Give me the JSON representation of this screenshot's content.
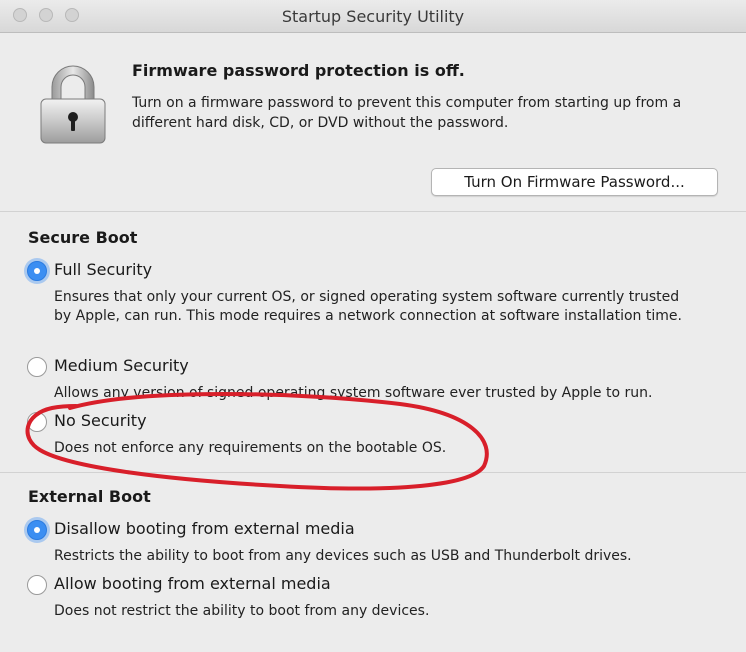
{
  "window": {
    "title": "Startup Security Utility"
  },
  "firmware": {
    "heading": "Firmware password protection is off.",
    "description": "Turn on a firmware password to prevent this computer from starting up from a different hard disk, CD, or DVD without the password.",
    "button_label": "Turn On Firmware Password..."
  },
  "secure_boot": {
    "title": "Secure Boot",
    "options": [
      {
        "label": "Full Security",
        "description": "Ensures that only your current OS, or signed operating system software currently trusted by Apple, can run. This mode requires a network connection at software installation time.",
        "selected": true
      },
      {
        "label": "Medium Security",
        "description": "Allows any version of signed operating system software ever trusted by Apple to run.",
        "selected": false
      },
      {
        "label": "No Security",
        "description": "Does not enforce any requirements on the bootable OS.",
        "selected": false
      }
    ]
  },
  "external_boot": {
    "title": "External Boot",
    "options": [
      {
        "label": "Disallow booting from external media",
        "description": "Restricts the ability to boot from any devices such as USB and Thunderbolt drives.",
        "selected": true
      },
      {
        "label": "Allow booting from external media",
        "description": "Does not restrict the ability to boot from any devices.",
        "selected": false
      }
    ]
  },
  "colors": {
    "accent": "#3b8ef2",
    "annotation": "#d81f2a"
  }
}
